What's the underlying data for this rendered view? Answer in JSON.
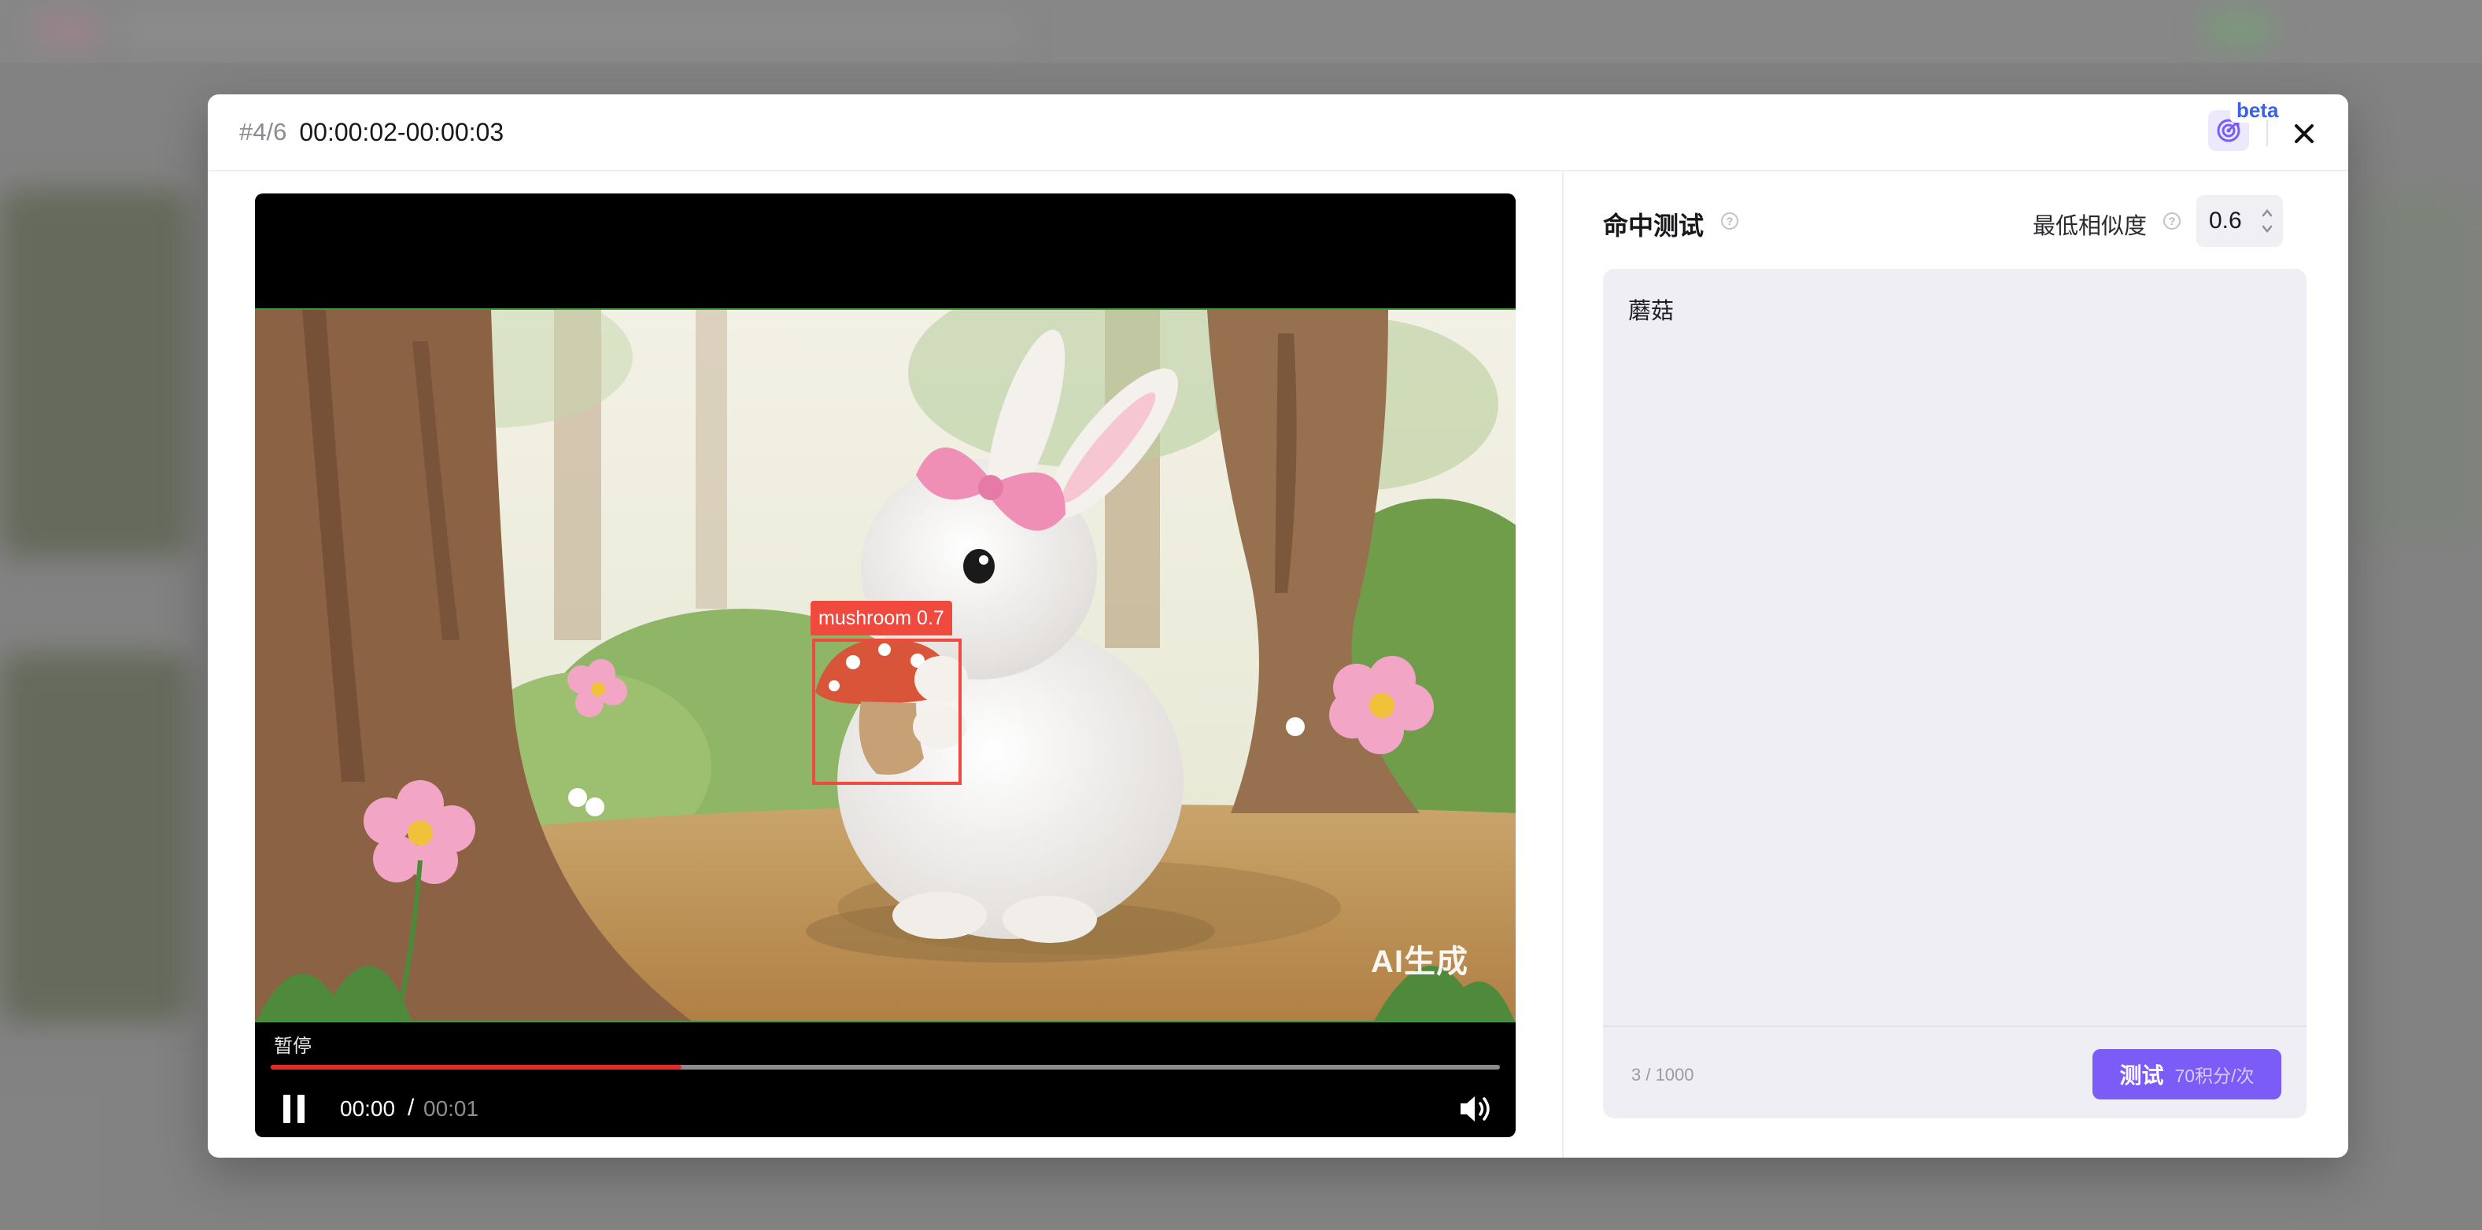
{
  "modal": {
    "counter": "#4/6",
    "time_range": "00:00:02-00:00:03",
    "beta_badge": "beta",
    "target_icon": "target-icon",
    "close_icon": "close-icon"
  },
  "player": {
    "watermark": "AI生成",
    "detection": {
      "label": "mushroom 0.7",
      "color": "#f04a3e"
    },
    "pause_tooltip": "暂停",
    "progress_fraction": 0.334,
    "current_time": "00:00",
    "separator": "/",
    "duration": "00:01",
    "play_icon": "pause-icon",
    "volume_icon": "volume-icon"
  },
  "hit_test": {
    "title": "命中测试",
    "similarity_label": "最低相似度",
    "similarity_value": "0.6",
    "query_text": "蘑菇",
    "char_count": "3 / 1000",
    "test_button_label": "测试",
    "test_button_cost": "70积分/次",
    "accent_color": "#7b5cf6"
  }
}
